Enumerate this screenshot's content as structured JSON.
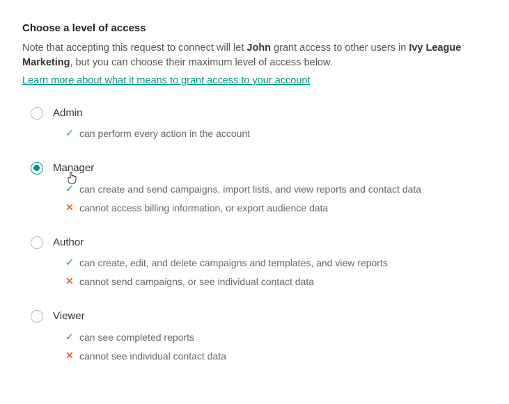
{
  "heading": "Choose a level of access",
  "desc_prefix": "Note that accepting this request to connect will let ",
  "user_name": "John",
  "desc_mid": " grant access to other users in ",
  "org_name": "Ivy League Marketing",
  "desc_suffix": ", but you can choose their maximum level of access below.",
  "learn_more": "Learn more about what it means to grant access to your account",
  "selected_index": 1,
  "options": [
    {
      "label": "Admin",
      "can": [
        "can perform every action in the account"
      ],
      "cannot": []
    },
    {
      "label": "Manager",
      "can": [
        "can create and send campaigns, import lists, and view reports and contact data"
      ],
      "cannot": [
        "cannot access billing information, or export audience data"
      ]
    },
    {
      "label": "Author",
      "can": [
        "can create, edit, and delete campaigns and templates, and view reports"
      ],
      "cannot": [
        "cannot send campaigns, or see individual contact data"
      ]
    },
    {
      "label": "Viewer",
      "can": [
        "can see completed reports"
      ],
      "cannot": [
        "cannot see individual contact data"
      ]
    }
  ]
}
